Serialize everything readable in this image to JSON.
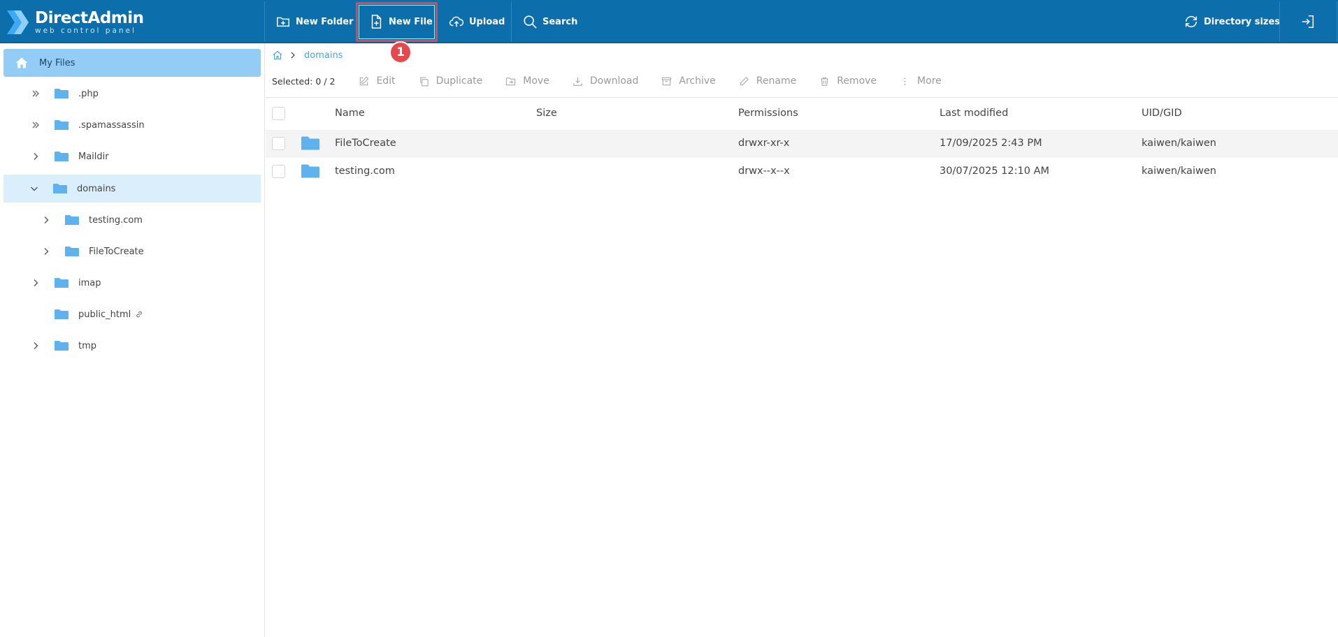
{
  "app": {
    "logo_title": "DirectAdmin",
    "logo_subtitle": "web control panel"
  },
  "toolbar": {
    "new_folder": "New Folder",
    "new_file": "New File",
    "upload": "Upload",
    "search": "Search",
    "directory_sizes": "Directory sizes"
  },
  "annotation": {
    "step": "1",
    "color": "#e5484d"
  },
  "sidebar": {
    "my_files": "My Files",
    "items": [
      {
        "label": ".php",
        "expander": "double-chevron"
      },
      {
        "label": ".spamassassin",
        "expander": "double-chevron"
      },
      {
        "label": "Maildir",
        "expander": "chevron-right"
      },
      {
        "label": "domains",
        "expander": "chevron-down",
        "selected": true
      },
      {
        "label": "testing.com",
        "expander": "chevron-right"
      },
      {
        "label": "FileToCreate",
        "expander": "chevron-right"
      },
      {
        "label": "imap",
        "expander": "chevron-right"
      },
      {
        "label": "public_html",
        "expander": "none",
        "symlink": true
      },
      {
        "label": "tmp",
        "expander": "chevron-right"
      }
    ]
  },
  "breadcrumb": {
    "current": "domains"
  },
  "actions": {
    "selected": "Selected: 0 / 2",
    "edit": "Edit",
    "duplicate": "Duplicate",
    "move": "Move",
    "download": "Download",
    "archive": "Archive",
    "rename": "Rename",
    "remove": "Remove",
    "more": "More"
  },
  "table": {
    "columns": {
      "name": "Name",
      "size": "Size",
      "permissions": "Permissions",
      "modified": "Last modified",
      "uid": "UID/GID"
    },
    "rows": [
      {
        "name": "FileToCreate",
        "size": "",
        "permissions": "drwxr-xr-x",
        "modified": "17/09/2025 2:43 PM",
        "uid": "kaiwen/kaiwen"
      },
      {
        "name": "testing.com",
        "size": "",
        "permissions": "drwx--x--x",
        "modified": "30/07/2025 12:10 AM",
        "uid": "kaiwen/kaiwen"
      }
    ]
  },
  "colors": {
    "topbar": "#0c6fab",
    "accent": "#4aa3df",
    "folder": "#5eb3ee",
    "sidebar_active": "#93cdf5"
  }
}
